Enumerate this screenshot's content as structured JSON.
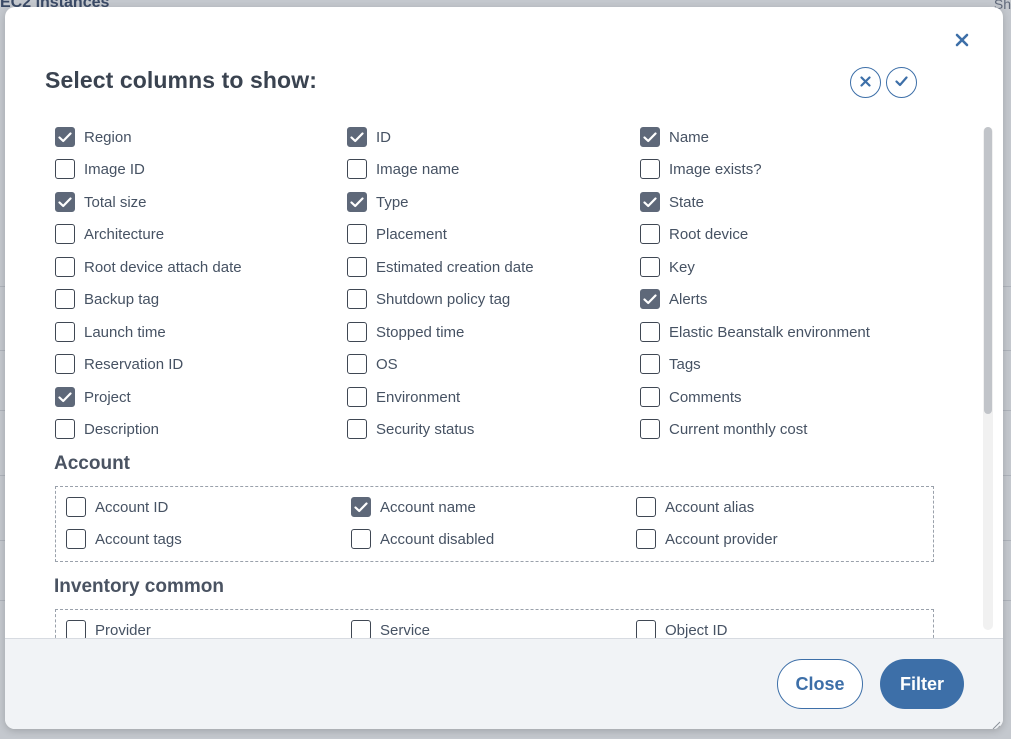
{
  "background": {
    "title_fragment": "EC2 instances",
    "right_fragment": "Sh"
  },
  "modal": {
    "title": "Select columns to show:",
    "close_icon": "close-icon",
    "deselect_all_icon": "x-circle-icon",
    "select_all_icon": "check-circle-icon"
  },
  "columns": [
    [
      {
        "label": "Region",
        "checked": true
      },
      {
        "label": "Image ID",
        "checked": false
      },
      {
        "label": "Total size",
        "checked": true
      },
      {
        "label": "Architecture",
        "checked": false
      },
      {
        "label": "Root device attach date",
        "checked": false
      },
      {
        "label": "Backup tag",
        "checked": false
      },
      {
        "label": "Launch time",
        "checked": false
      },
      {
        "label": "Reservation ID",
        "checked": false
      },
      {
        "label": "Project",
        "checked": true
      },
      {
        "label": "Description",
        "checked": false
      }
    ],
    [
      {
        "label": "ID",
        "checked": true
      },
      {
        "label": "Image name",
        "checked": false
      },
      {
        "label": "Type",
        "checked": true
      },
      {
        "label": "Placement",
        "checked": false
      },
      {
        "label": "Estimated creation date",
        "checked": false
      },
      {
        "label": "Shutdown policy tag",
        "checked": false
      },
      {
        "label": "Stopped time",
        "checked": false
      },
      {
        "label": "OS",
        "checked": false
      },
      {
        "label": "Environment",
        "checked": false
      },
      {
        "label": "Security status",
        "checked": false
      }
    ],
    [
      {
        "label": "Name",
        "checked": true
      },
      {
        "label": "Image exists?",
        "checked": false
      },
      {
        "label": "State",
        "checked": true
      },
      {
        "label": "Root device",
        "checked": false
      },
      {
        "label": "Key",
        "checked": false
      },
      {
        "label": "Alerts",
        "checked": true
      },
      {
        "label": "Elastic Beanstalk environment",
        "checked": false
      },
      {
        "label": "Tags",
        "checked": false
      },
      {
        "label": "Comments",
        "checked": false
      },
      {
        "label": "Current monthly cost",
        "checked": false
      }
    ]
  ],
  "sections": [
    {
      "title": "Account",
      "items": [
        [
          {
            "label": "Account ID",
            "checked": false
          },
          {
            "label": "Account tags",
            "checked": false
          }
        ],
        [
          {
            "label": "Account name",
            "checked": true
          },
          {
            "label": "Account disabled",
            "checked": false
          }
        ],
        [
          {
            "label": "Account alias",
            "checked": false
          },
          {
            "label": "Account provider",
            "checked": false
          }
        ]
      ]
    },
    {
      "title": "Inventory common",
      "items": [
        [
          {
            "label": "Provider",
            "checked": false
          }
        ],
        [
          {
            "label": "Service",
            "checked": false
          }
        ],
        [
          {
            "label": "Object ID",
            "checked": false
          }
        ]
      ]
    }
  ],
  "footer": {
    "close_label": "Close",
    "filter_label": "Filter"
  },
  "colors": {
    "accent": "#3d6fa8",
    "checked_fill": "#5e6879"
  }
}
